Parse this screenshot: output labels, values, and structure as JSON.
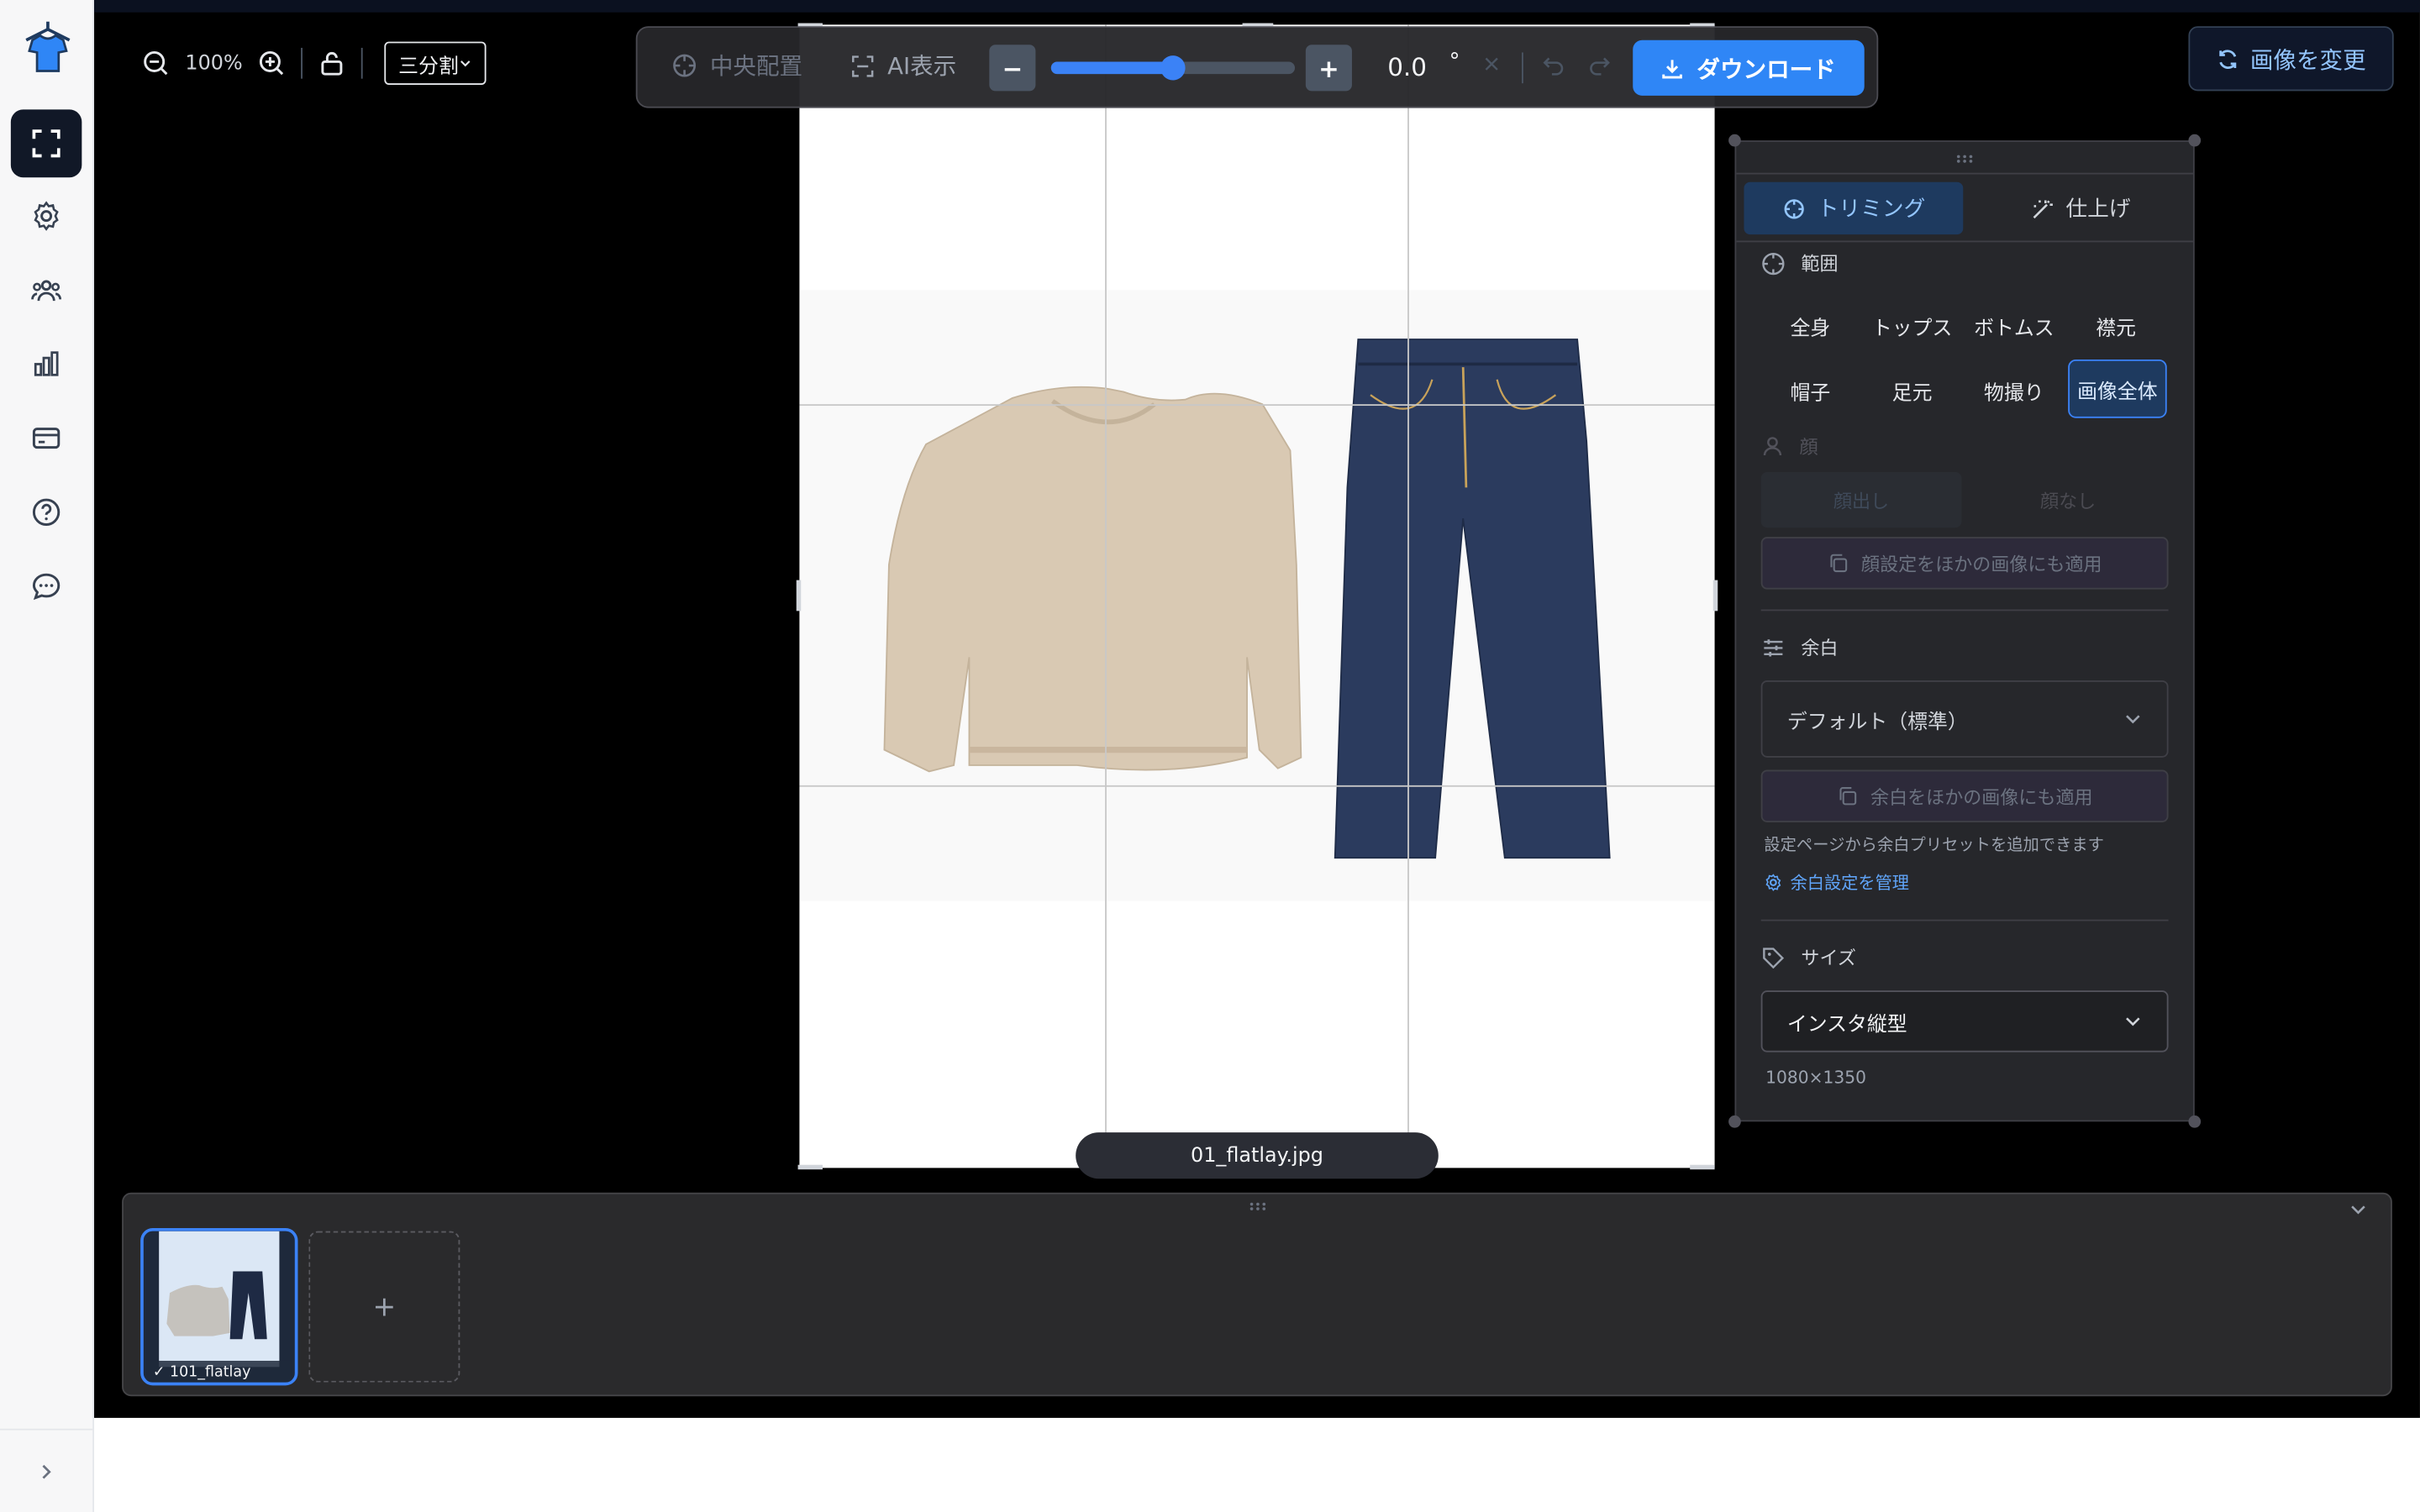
{
  "toolbar": {
    "zoom": "100%",
    "grid_mode": "三分割",
    "center_label": "中央配置",
    "ai_label": "AI表示",
    "minus": "−",
    "plus": "+",
    "rotation_value": "0.0",
    "rotation_unit": "°",
    "rotation_slider_fraction": 0.5,
    "download_label": "ダウンロード"
  },
  "change_image_label": "画像を変更",
  "canvas": {
    "filename": "01_flatlay.jpg"
  },
  "panel": {
    "tab_trim": "トリミング",
    "tab_finish": "仕上げ",
    "range_label": "範囲",
    "crop_options": [
      "全身",
      "トップス",
      "ボトムス",
      "襟元",
      "帽子",
      "足元",
      "物撮り",
      "画像全体"
    ],
    "crop_selected": "画像全体",
    "face_label": "顔",
    "face_show": "顔出し",
    "face_hide": "顔なし",
    "face_apply": "顔設定をほかの画像にも適用",
    "margin_label": "余白",
    "margin_value": "デフォルト（標準）",
    "margin_apply": "余白をほかの画像にも適用",
    "margin_hint": "設定ページから余白プリセットを追加できます",
    "margin_manage": "余白設定を管理",
    "size_label": "サイズ",
    "size_value": "インスタ縦型",
    "size_dims": "1080×1350"
  },
  "filmstrip": {
    "thumb_label": "101_flatlay",
    "check": "✓",
    "add_label": "+"
  },
  "colors": {
    "accent": "#2f86f6",
    "selected_bg": "#1e3a5f",
    "sidebar_active": "#111827"
  }
}
